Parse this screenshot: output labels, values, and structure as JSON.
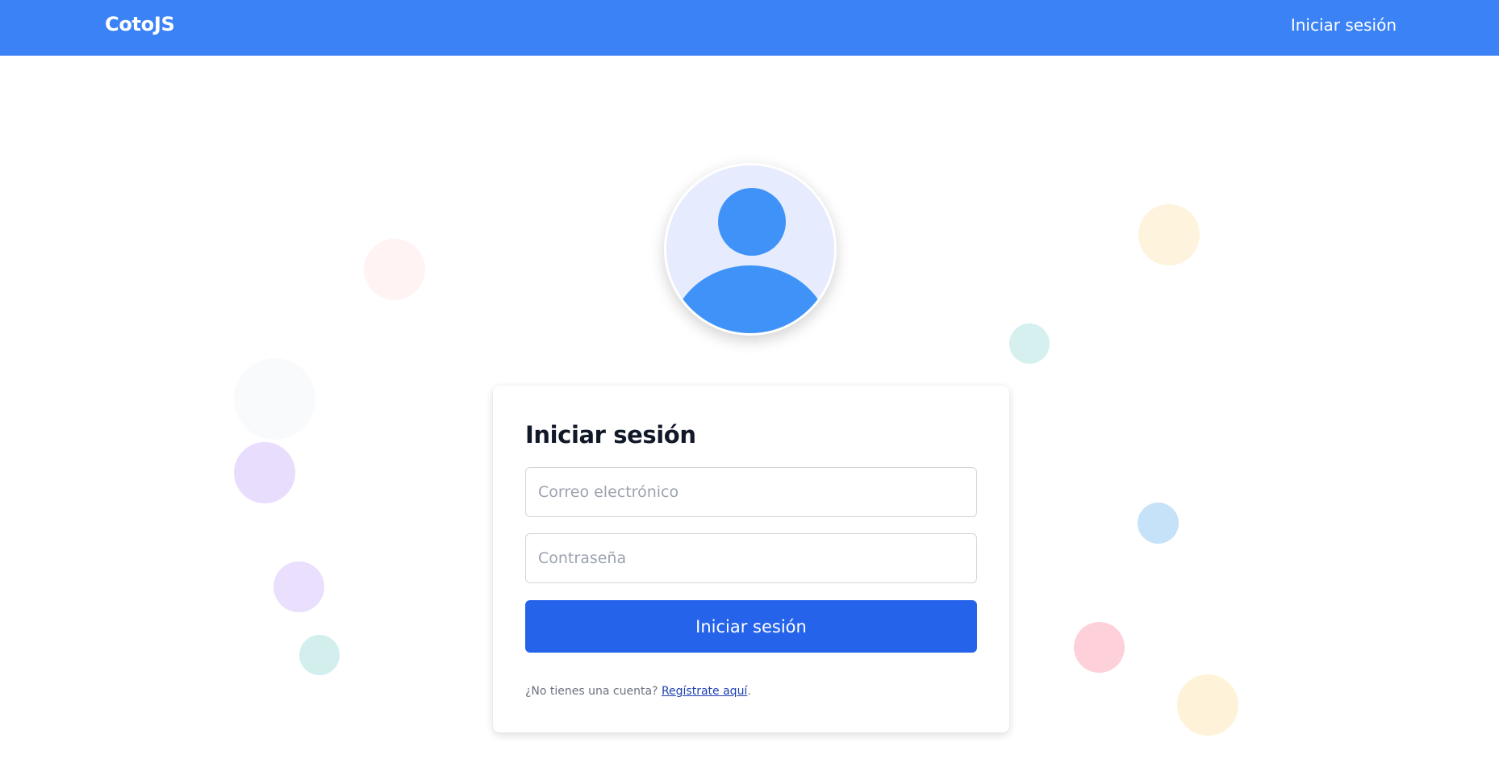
{
  "navbar": {
    "brand": "CotoJS",
    "login_link": "Iniciar sesión",
    "background": "#3b82f6"
  },
  "avatar": {
    "icon": "user-avatar-icon",
    "background": "#e6ecfd",
    "figure_color": "#3f93f8"
  },
  "login_form": {
    "title": "Iniciar sesión",
    "email": {
      "value": "",
      "placeholder": "Correo electrónico"
    },
    "password": {
      "value": "",
      "placeholder": "Contraseña"
    },
    "submit_label": "Iniciar sesión",
    "signup_prompt": "¿No tienes una cuenta?",
    "signup_link": "Regístrate aquí",
    "signup_suffix": ".",
    "button_color": "#2563eb"
  },
  "decorative_dots": [
    {
      "color": "#fff1f2",
      "opacity": 0.85
    },
    {
      "color": "#f8fafc",
      "opacity": 1
    },
    {
      "color": "#e9ddfe",
      "opacity": 1
    },
    {
      "color": "#eadffd",
      "opacity": 1
    },
    {
      "color": "#d2efee",
      "opacity": 1
    },
    {
      "color": "#fef3dc",
      "opacity": 1
    },
    {
      "color": "#d5f0ef",
      "opacity": 1
    },
    {
      "color": "#c6e2f8",
      "opacity": 1
    },
    {
      "color": "#fed1da",
      "opacity": 1
    },
    {
      "color": "#fef2d9",
      "opacity": 1
    }
  ]
}
